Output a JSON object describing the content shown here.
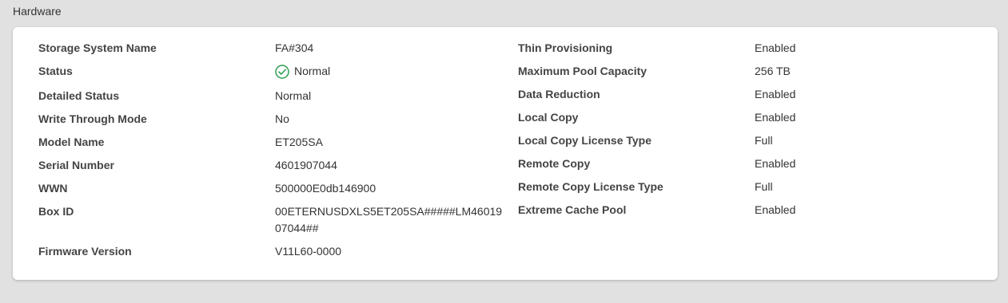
{
  "section": {
    "title": "Hardware"
  },
  "left": [
    {
      "label": "Storage System Name",
      "value": "FA#304"
    },
    {
      "label": "Status",
      "value": "Normal",
      "icon": "check-circle-icon"
    },
    {
      "label": "Detailed Status",
      "value": "Normal"
    },
    {
      "label": "Write Through Mode",
      "value": "No"
    },
    {
      "label": "Model Name",
      "value": "ET205SA"
    },
    {
      "label": "Serial Number",
      "value": "4601907044"
    },
    {
      "label": "WWN",
      "value": "500000E0db146900"
    },
    {
      "label": "Box ID",
      "value": "00ETERNUSDXLS5ET205SA#####LM4601907044##"
    },
    {
      "label": "Firmware Version",
      "value": "V11L60-0000"
    }
  ],
  "right": [
    {
      "label": "Thin Provisioning",
      "value": "Enabled"
    },
    {
      "label": "Maximum Pool Capacity",
      "value": "256 TB"
    },
    {
      "label": "Data Reduction",
      "value": "Enabled"
    },
    {
      "label": "Local Copy",
      "value": "Enabled"
    },
    {
      "label": "Local Copy License Type",
      "value": "Full"
    },
    {
      "label": "Remote Copy",
      "value": "Enabled"
    },
    {
      "label": "Remote Copy License Type",
      "value": "Full"
    },
    {
      "label": "Extreme Cache Pool",
      "value": "Enabled"
    }
  ],
  "colors": {
    "background": "#e1e1e1",
    "card": "#ffffff",
    "status_ok": "#2e9e4f"
  }
}
